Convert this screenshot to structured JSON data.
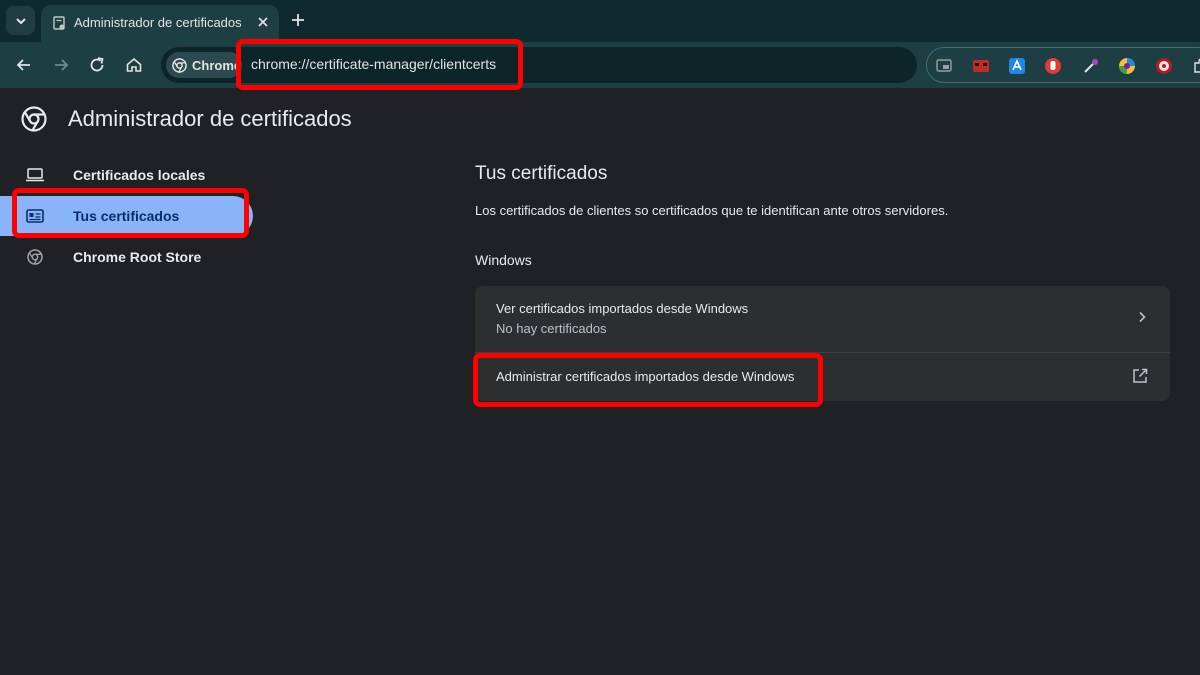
{
  "browser": {
    "tab": {
      "title": "Administrador de certificados"
    },
    "omnibox": {
      "chip_label": "Chrome",
      "url": "chrome://certificate-manager/clientcerts"
    },
    "extensions": [
      {
        "name": "picture-in-picture-icon",
        "color": "#3c4043"
      },
      {
        "name": "extension-red-face-icon",
        "color": "#c62828"
      },
      {
        "name": "extension-blue-a-icon",
        "color": "#1e88e5"
      },
      {
        "name": "extension-red-hand-icon",
        "color": "#e53935"
      },
      {
        "name": "eyedropper-icon",
        "color": "#ab47bc"
      },
      {
        "name": "extension-colorful-circle-icon",
        "color": "#fbc02d"
      },
      {
        "name": "extension-shield-icon",
        "color": "#b71c1c"
      }
    ]
  },
  "page": {
    "title": "Administrador de certificados",
    "sidebar": {
      "items": [
        {
          "label": "Certificados locales",
          "icon": "laptop-icon"
        },
        {
          "label": "Tus certificados",
          "icon": "id-card-icon",
          "active": true
        },
        {
          "label": "Chrome Root Store",
          "icon": "chrome-icon"
        }
      ]
    },
    "main": {
      "section_title": "Tus certificados",
      "description": "Los certificados de clientes so certificados que te identifican ante otros servidores.",
      "group_title": "Windows",
      "rows": [
        {
          "title": "Ver certificados importados desde Windows",
          "subtitle": "No hay certificados"
        },
        {
          "title": "Administrar certificados importados desde Windows"
        }
      ]
    }
  }
}
